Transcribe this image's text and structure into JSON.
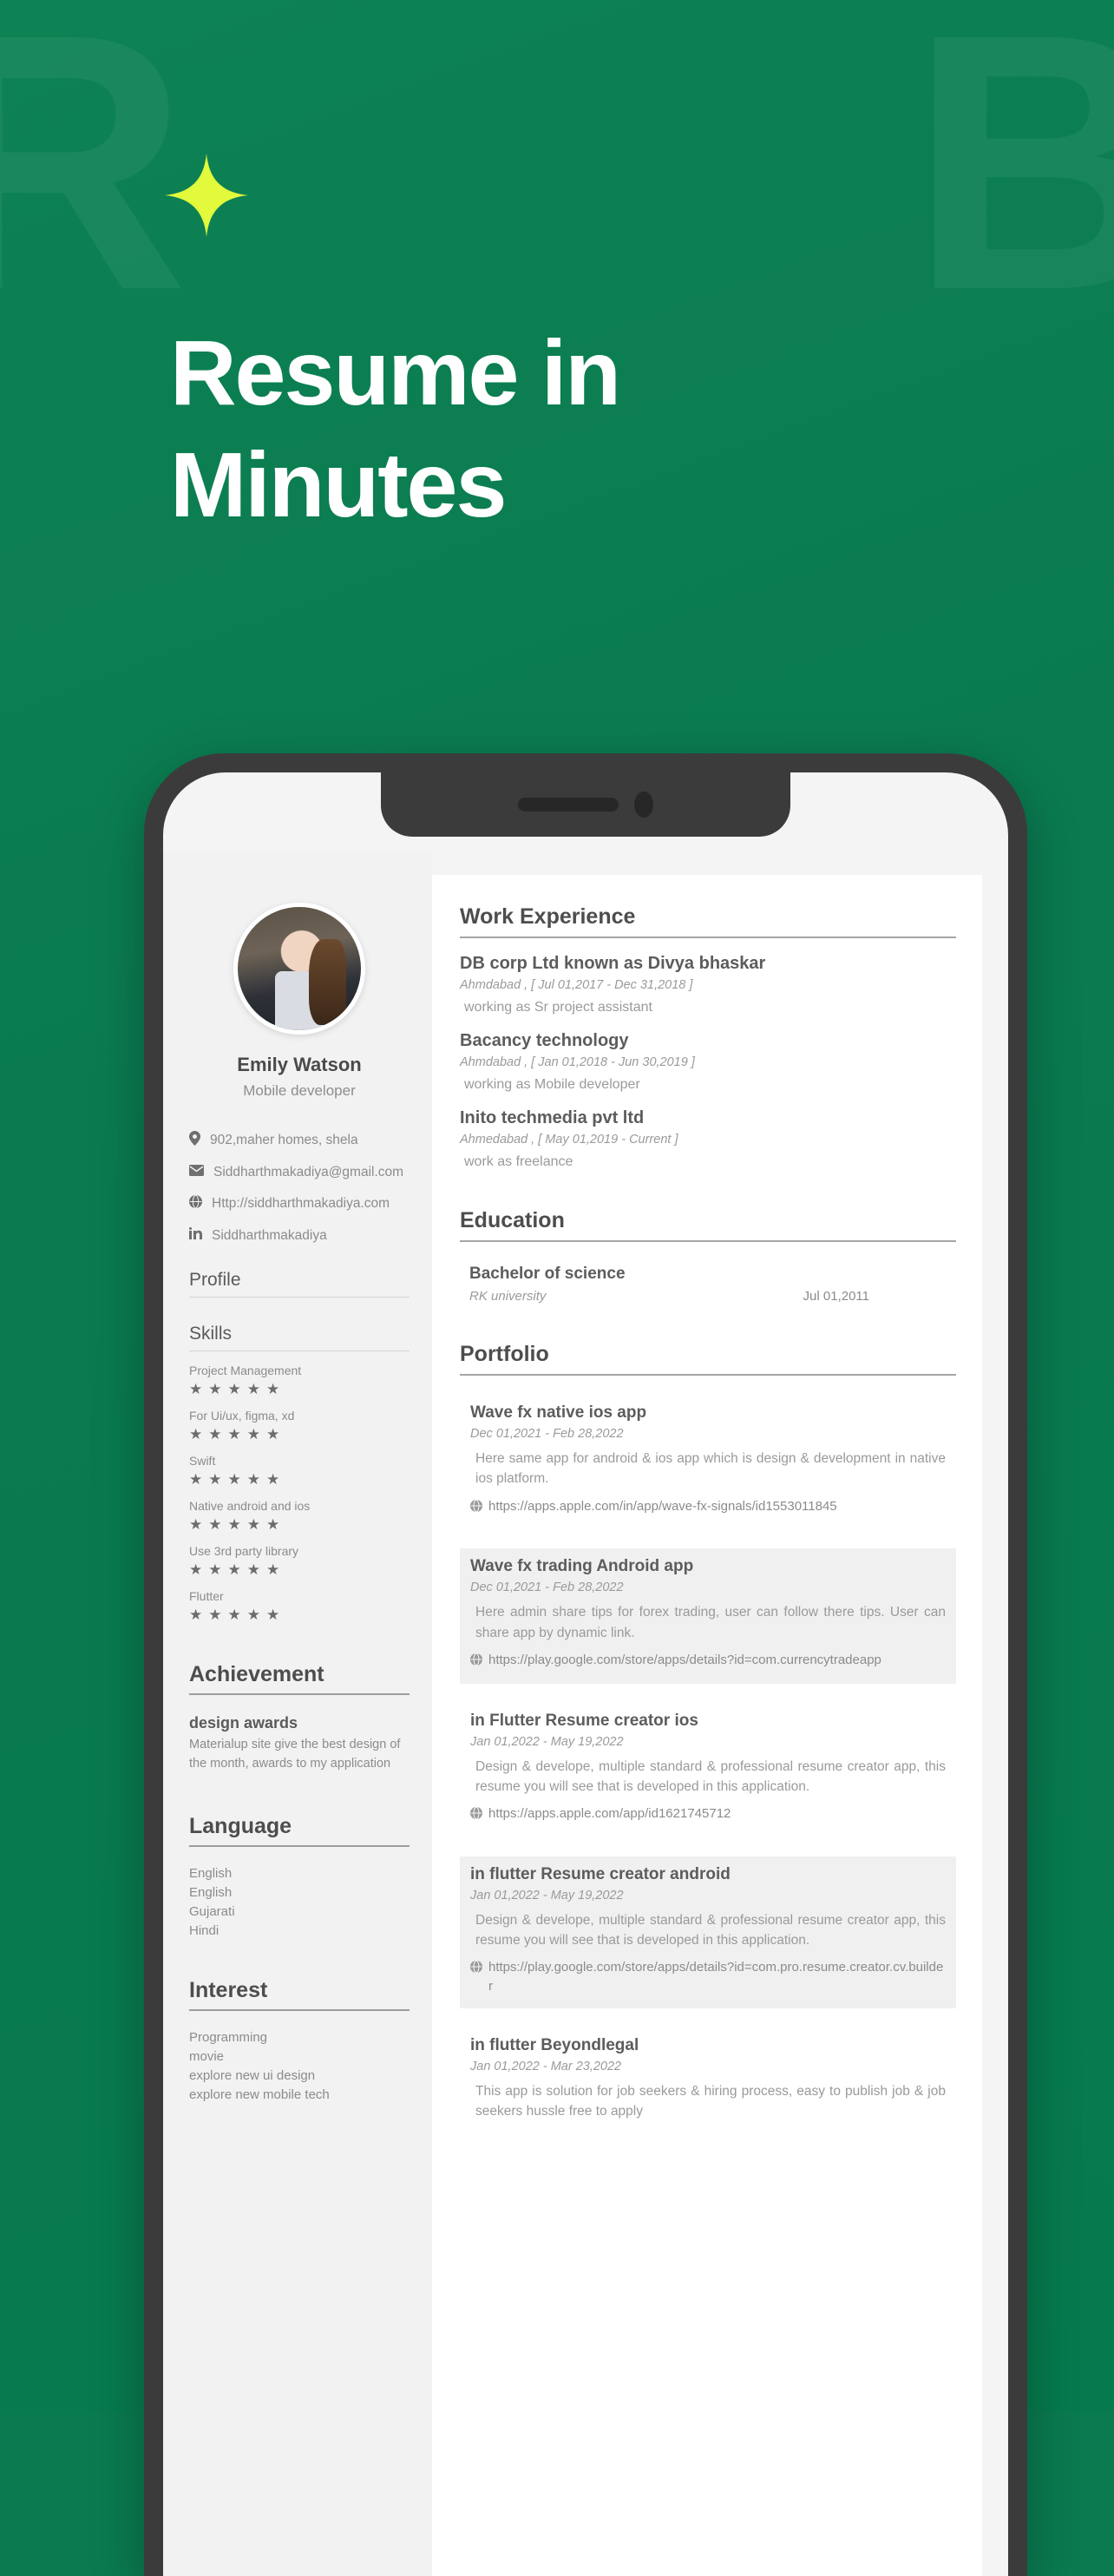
{
  "hero": {
    "sparkle_icon": "sparkle-icon",
    "headline_line1": "Resume in",
    "headline_line2": "Minutes",
    "brand_watermark_left": "R",
    "brand_watermark_right": "B",
    "background_color": "#0a7a50",
    "sparkle_color": "#e2f93c",
    "headline_color": "#ffffff"
  },
  "resume": {
    "sidebar": {
      "name": "Emily Watson",
      "role": "Mobile developer",
      "contacts": [
        {
          "icon": "location-pin-icon",
          "text": "902,maher homes, shela"
        },
        {
          "icon": "envelope-icon",
          "text": "Siddharthmakadiya@gmail.com"
        },
        {
          "icon": "globe-icon",
          "text": "Http://siddharthmakadiya.com"
        },
        {
          "icon": "linkedin-icon",
          "text": "Siddharthmakadiya"
        }
      ],
      "profile_heading": "Profile",
      "skills_heading": "Skills",
      "skills": [
        {
          "label": "Project Management",
          "rating": 5
        },
        {
          "label": "For Ui/ux, figma, xd",
          "rating": 5
        },
        {
          "label": "Swift",
          "rating": 5
        },
        {
          "label": "Native android and ios",
          "rating": 5
        },
        {
          "label": "Use 3rd party library",
          "rating": 5
        },
        {
          "label": "Flutter",
          "rating": 5
        }
      ],
      "achievement_heading": "Achievement",
      "achievement": {
        "title": "design awards",
        "description": "Materialup site give the best design of the month, awards to my application"
      },
      "language_heading": "Language",
      "languages": [
        "English",
        "English",
        "Gujarati",
        "Hindi"
      ],
      "interest_heading": "Interest",
      "interests": [
        "Programming",
        "movie",
        "explore new ui design",
        "explore new mobile tech"
      ]
    },
    "main": {
      "work_heading": "Work Experience",
      "jobs": [
        {
          "title": "DB corp Ltd known as Divya bhaskar",
          "meta": "Ahmdabad , [ Jul 01,2017 - Dec 31,2018 ]",
          "description": "working as Sr project assistant"
        },
        {
          "title": "Bacancy technology",
          "meta": "Ahmdabad , [ Jan 01,2018 - Jun 30,2019 ]",
          "description": "working as Mobile developer"
        },
        {
          "title": "Inito techmedia pvt ltd",
          "meta": "Ahmedabad , [ May 01,2019 - Current ]",
          "description": "work as freelance"
        }
      ],
      "education_heading": "Education",
      "education": [
        {
          "degree": "Bachelor of science",
          "school": "RK university",
          "date": "Jul 01,2011"
        }
      ],
      "portfolio_heading": "Portfolio",
      "portfolio": [
        {
          "title": "Wave fx native ios app",
          "date": "Dec 01,2021 - Feb 28,2022",
          "description": "Here same app for android & ios app which is design & development in native ios platform.",
          "link": "https://apps.apple.com/in/app/wave-fx-signals/id1553011845",
          "highlighted": false
        },
        {
          "title": "Wave fx trading Android app",
          "date": "Dec 01,2021 - Feb 28,2022",
          "description": "Here admin share tips for forex trading, user can follow there tips. User can share app by dynamic link.",
          "link": "https://play.google.com/store/apps/details?id=com.currencytradeapp",
          "highlighted": true
        },
        {
          "title": "in Flutter Resume creator ios",
          "date": "Jan 01,2022 - May 19,2022",
          "description": "Design & develope, multiple standard & professional resume creator app, this resume you will see that is developed in this application.",
          "link": "https://apps.apple.com/app/id1621745712",
          "highlighted": false
        },
        {
          "title": "in flutter Resume creator android",
          "date": "Jan 01,2022 - May 19,2022",
          "description": "Design & develope, multiple standard & professional resume creator app, this resume you will see that is developed in this application.",
          "link": "https://play.google.com/store/apps/details?id=com.pro.resume.creator.cv.builder",
          "highlighted": true
        },
        {
          "title": "in flutter Beyondlegal",
          "date": "Jan 01,2022 - Mar 23,2022",
          "description": "This app is solution for job seekers & hiring process, easy to publish job & job seekers hussle free to apply",
          "link": "",
          "highlighted": false
        }
      ]
    }
  }
}
